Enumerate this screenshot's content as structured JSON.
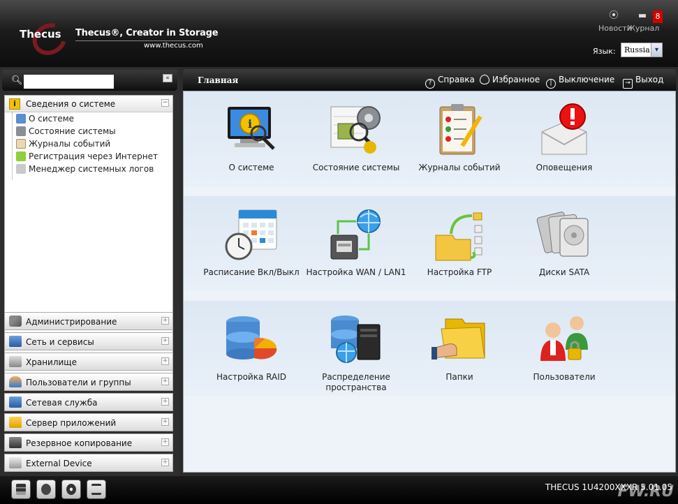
{
  "header": {
    "logo_text": "Thecus",
    "tagline": "Thecus®, Creator in Storage",
    "website": "www.thecus.com",
    "news_label": "Новости",
    "journal_label": "Журнал",
    "notification_count": "8",
    "language_label": "Язык:",
    "language_value": "Russia"
  },
  "sidebar": {
    "search_placeholder": "",
    "section": {
      "label": "Сведения о системе",
      "items": [
        {
          "label": "О системе"
        },
        {
          "label": "Состояние системы"
        },
        {
          "label": "Журналы событий"
        },
        {
          "label": "Регистрация через Интернет"
        },
        {
          "label": "Менеджер системных логов"
        }
      ]
    },
    "categories": [
      {
        "label": "Администрирование"
      },
      {
        "label": "Сеть и сервисы"
      },
      {
        "label": "Хранилище"
      },
      {
        "label": "Пользователи и группы"
      },
      {
        "label": "Сетевая служба"
      },
      {
        "label": "Сервер приложений"
      },
      {
        "label": "Резервное копирование"
      },
      {
        "label": "External Device"
      }
    ]
  },
  "topbar": {
    "title": "Главная",
    "help": "Справка",
    "favorites": "Избранное",
    "shutdown": "Выключение",
    "logout": "Выход"
  },
  "tiles": [
    {
      "label": "О системе",
      "icon": "system-info-icon"
    },
    {
      "label": "Состояние системы",
      "icon": "system-status-icon"
    },
    {
      "label": "Журналы событий",
      "icon": "event-log-icon"
    },
    {
      "label": "Оповещения",
      "icon": "notifications-icon"
    },
    {
      "label": "Расписание Вкл/Выкл",
      "icon": "schedule-icon"
    },
    {
      "label": "Настройка WAN / LAN1",
      "icon": "network-icon"
    },
    {
      "label": "Настройка FTP",
      "icon": "ftp-icon"
    },
    {
      "label": "Диски SATA",
      "icon": "disks-icon"
    },
    {
      "label": "Настройка RAID",
      "icon": "raid-icon"
    },
    {
      "label": "Распределение пространства",
      "icon": "space-allocation-icon"
    },
    {
      "label": "Папки",
      "icon": "folders-icon"
    },
    {
      "label": "Пользователи",
      "icon": "users-icon"
    }
  ],
  "footer": {
    "version": "THECUS 1U4200XXXR 5.01.05",
    "watermark": "FW.RU"
  }
}
